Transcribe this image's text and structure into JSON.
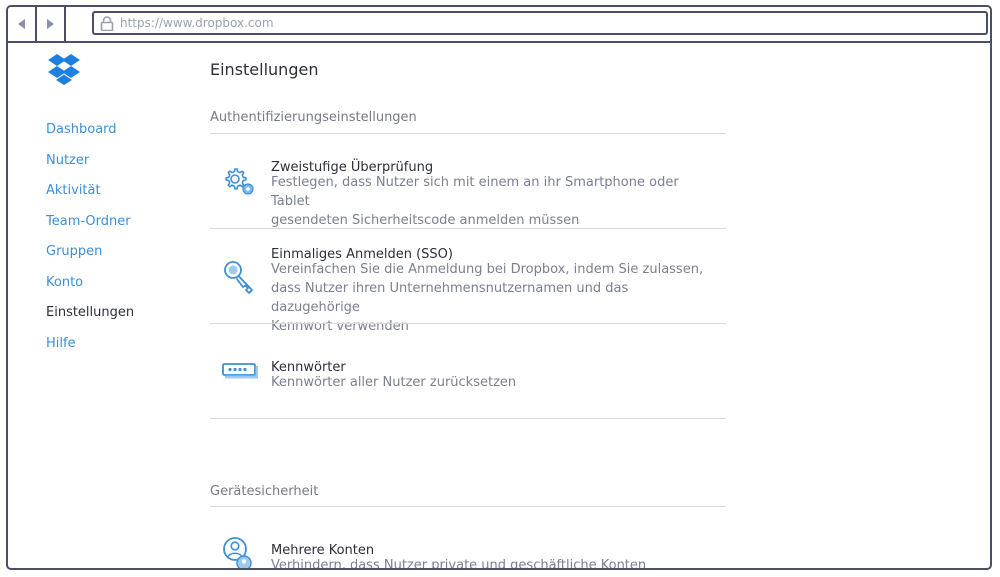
{
  "browser": {
    "url": "https://www.dropbox.com",
    "back_icon": "back-arrow-icon",
    "forward_icon": "forward-arrow-icon",
    "lock_icon": "lock-icon"
  },
  "sidebar": {
    "items": [
      {
        "label": "Dashboard",
        "active": false
      },
      {
        "label": "Nutzer",
        "active": false
      },
      {
        "label": "Aktivität",
        "active": false
      },
      {
        "label": "Team-Ordner",
        "active": false
      },
      {
        "label": "Gruppen",
        "active": false
      },
      {
        "label": "Konto",
        "active": false
      },
      {
        "label": "Einstellungen",
        "active": true
      },
      {
        "label": "Hilfe",
        "active": false
      }
    ]
  },
  "main": {
    "title": "Einstellungen",
    "sections": [
      {
        "title": "Authentifizierungseinstellungen",
        "rows": [
          {
            "icon": "gear-icon",
            "title": "Zweistufige Überprüfung",
            "desc_lines": [
              "Festlegen, dass Nutzer sich mit einem an ihr Smartphone oder Tablet",
              "gesendeten Sicherheitscode anmelden müssen"
            ]
          },
          {
            "icon": "key-icon",
            "title": "Einmaliges Anmelden (SSO)",
            "desc_lines": [
              "Vereinfachen Sie die Anmeldung bei Dropbox, indem Sie zulassen,",
              "dass Nutzer ihren Unternehmensnutzernamen und das dazugehörige",
              "Kennwort verwenden"
            ]
          },
          {
            "icon": "password-icon",
            "title": "Kennwörter",
            "desc_lines": [
              "Kennwörter aller Nutzer zurücksetzen"
            ]
          }
        ]
      },
      {
        "title": "Gerätesicherheit",
        "rows": [
          {
            "icon": "multiple-accounts-icon",
            "title": "Mehrere Konten",
            "desc_lines": [
              "Verhindern, dass Nutzer private und geschäftliche Konten verknüpfen"
            ]
          }
        ]
      }
    ]
  },
  "colors": {
    "link": "#3d8fd6",
    "frame": "#4a4f66",
    "text": "#2b2f3a",
    "muted": "#7a8090",
    "brand": "#1f7fe0"
  }
}
